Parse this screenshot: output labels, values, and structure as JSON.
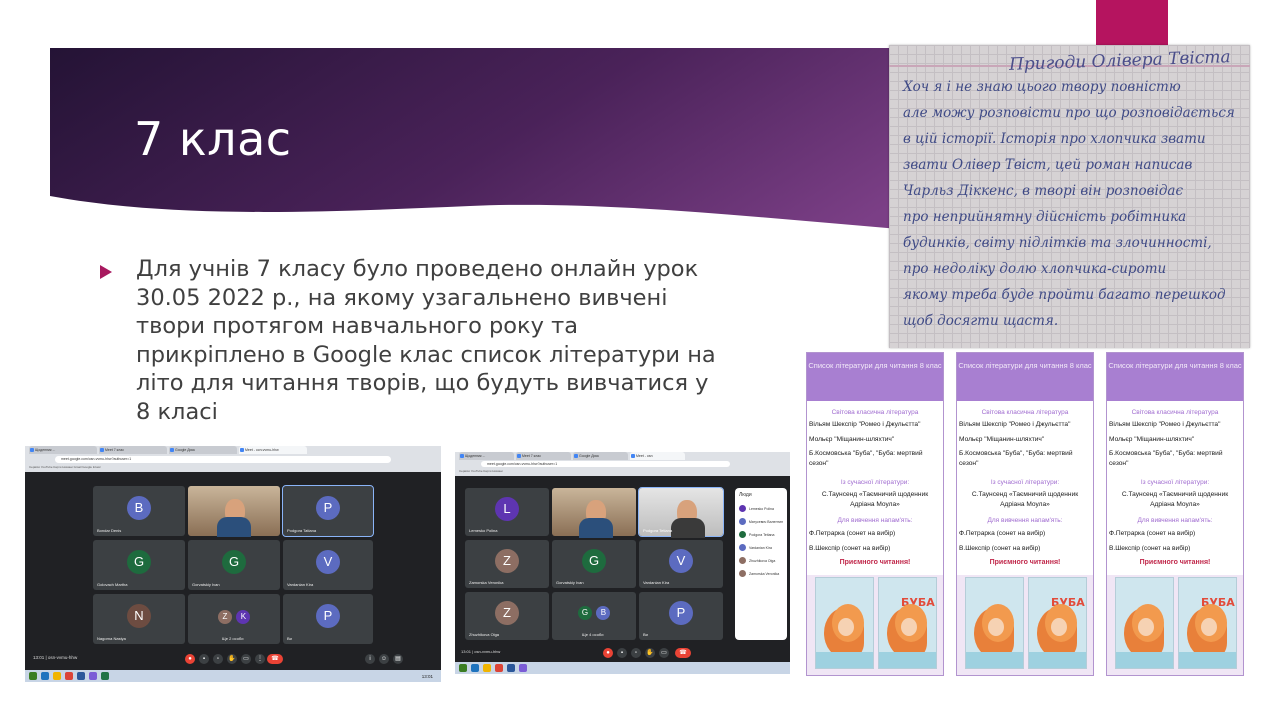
{
  "slide": {
    "title": "7 клас",
    "bullet": "Для учнів 7 класу було проведено онлайн урок 30.05 2022 р., на якому узагальнено вивчені твори протягом навчального року та прикріплено в Google клас список літератури на літо для читання творів, що будуть вивчатися у 8 класі"
  },
  "colors": {
    "accent": "#b5145f",
    "band_dark": "#241335",
    "band_light": "#6a3a78",
    "bullet": "#a8195f",
    "booklist_header": "#a87fd1"
  },
  "notebook": {
    "title": "Пригоди Олівера Твіста",
    "lines": [
      "Хоч я і не знаю цього твору повністю",
      "але можу розповісти про що розповідається",
      "в цій історії. Історія про хлопчика звати",
      "звати Олівер Твіст, цей роман написав",
      "Чарльз Діккенс, в творі він розповідає",
      "про неприйнятну дійсність робітника",
      "будинків, світу підлітків та злочинності,",
      "про недоліку долю хлопчика-сироти",
      "якому треба буде пройти багато перешкод",
      "щоб досягти щастя."
    ]
  },
  "meet1": {
    "tabs": [
      "Щоденник ...",
      "Meet 7 клас",
      "Google Диск",
      "Мeet - осн-vvmu-hhw"
    ],
    "url": "meet.google.com/osn-vvmu-hhw?authuser=1",
    "bookmarks": "Сервіси  YouTube  Карти  Новини  Gmail  Google Класс",
    "tiles": [
      {
        "initial": "B",
        "name": "Bondar Denis",
        "color": "#5c6bc0"
      },
      {
        "initial": "",
        "name": "",
        "color": "",
        "camera": true
      },
      {
        "initial": "P",
        "name": "Podgora Tatiana",
        "color": "#5c6bc0"
      },
      {
        "initial": "G",
        "name": "Golovach Martha",
        "color": "#1e6b3e"
      },
      {
        "initial": "G",
        "name": "Gorvatskiy Ivan",
        "color": "#1e6b3e"
      },
      {
        "initial": "V",
        "name": "Vardanian Kira",
        "color": "#5c6bc0"
      },
      {
        "initial": "N",
        "name": "Nagorna Nastya",
        "color": "#6d4c41"
      },
      {
        "initial": "",
        "name": "Ще 2 особи",
        "color": "",
        "group": [
          "Z",
          "K"
        ]
      },
      {
        "initial": "P",
        "name": "Ви",
        "color": "#5c6bc0"
      }
    ],
    "meeting_code": "13:01  |  osn-vvmu-hhw",
    "taskbar_time": "13:01"
  },
  "meet2": {
    "tabs": [
      "Щоденник ...",
      "Meet 7 клас",
      "Google Диск",
      "Мeet - osn"
    ],
    "url": "meet.google.com/osn-vvmu-hhw?authuser=1",
    "bookmarks": "Сервіси  YouTube  Карти  Новини",
    "tiles": [
      {
        "initial": "L",
        "name": "Lemesko Polina",
        "color": "#5e35b1"
      },
      {
        "initial": "",
        "name": "",
        "camera": true
      },
      {
        "initial": "",
        "name": "Podgora Tetiana",
        "camera": true
      },
      {
        "initial": "Z",
        "name": "Zamorska Veronika",
        "color": "#8d6e63"
      },
      {
        "initial": "G",
        "name": "Gorvatskiy Ivan",
        "color": "#1e6b3e"
      },
      {
        "initial": "V",
        "name": "Vardanian Kira",
        "color": "#5c6bc0"
      },
      {
        "initial": "Z",
        "name": "Zhuzhikova Olga",
        "color": "#8d6e63"
      },
      {
        "initial": "",
        "name": "Ще 4 особи",
        "group": [
          "G",
          "B"
        ]
      },
      {
        "initial": "P",
        "name": "Ви",
        "color": "#5c6bc0"
      }
    ],
    "people_title": "Люди",
    "people": [
      "Lemesko Polina",
      "Mатусевич Валентин",
      "Podgora Tetiana",
      "Vardanian Kira",
      "Zhuzhikova Olga",
      "Zamorska Veronika"
    ],
    "meeting_code": "13:01  |  osn-vvmu-hhw"
  },
  "booklist": {
    "header": "Список літератури для читання 8 клас",
    "sections": {
      "foreign": "Світова класична література",
      "modern": "Із сучасної літератури:",
      "memorize": "Для вивчення напам'ять:"
    },
    "classic_items": [
      "Вільям Шекспір \"Ромео і Джульєтта\"",
      "Мольєр \"Міщанин-шляхтич\"",
      "Б.Космовська \"Буба\", \"Буба: мертвий сезон\""
    ],
    "modern_items": [
      "С.Таунсенд «Таємничий щоденник Адріана Моула»"
    ],
    "memorize_items": [
      "Ф.Петрарка  (сонет на вибір)",
      "В.Шекспір  (сонет на вибір)"
    ],
    "wish": "Приємного читання!",
    "cover_title": "БУБА"
  }
}
